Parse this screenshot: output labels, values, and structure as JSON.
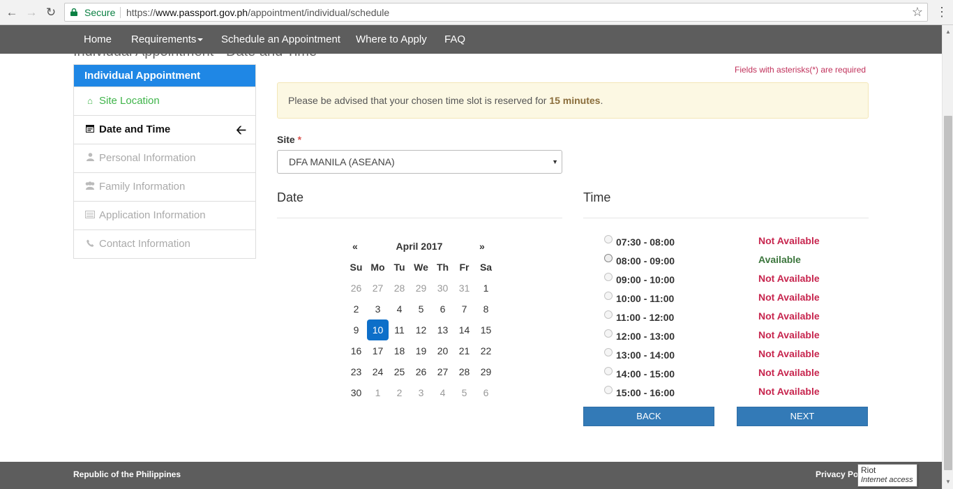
{
  "browser": {
    "secure_label": "Secure",
    "url_scheme": "https://",
    "url_host": "www.passport.gov.ph",
    "url_path": "/appointment/individual/schedule"
  },
  "nav": {
    "home": "Home",
    "requirements": "Requirements",
    "schedule": "Schedule an Appointment",
    "where": "Where to Apply",
    "faq": "FAQ"
  },
  "page_heading": "Individual Appointment - Date and Time",
  "sidebar": {
    "title": "Individual Appointment",
    "items": [
      {
        "label": "Site Location",
        "icon": "home-icon",
        "state": "done"
      },
      {
        "label": "Date and Time",
        "icon": "calendar-icon",
        "state": "active"
      },
      {
        "label": "Personal Information",
        "icon": "user-icon",
        "state": "pending"
      },
      {
        "label": "Family Information",
        "icon": "users-icon",
        "state": "pending"
      },
      {
        "label": "Application Information",
        "icon": "list-icon",
        "state": "pending"
      },
      {
        "label": "Contact Information",
        "icon": "phone-icon",
        "state": "pending"
      }
    ]
  },
  "required_note": "Fields with asterisks(*) are required",
  "alert": {
    "text": "Please be advised that your chosen time slot is reserved for ",
    "bold": "15 minutes",
    "end": "."
  },
  "site": {
    "label": "Site",
    "asterisk": "*",
    "value": "DFA MANILA (ASEANA)"
  },
  "date_title": "Date",
  "time_title": "Time",
  "calendar": {
    "prev": "«",
    "next": "»",
    "month": "April 2017",
    "weekdays": [
      "Su",
      "Mo",
      "Tu",
      "We",
      "Th",
      "Fr",
      "Sa"
    ],
    "weeks": [
      [
        "26",
        "27",
        "28",
        "29",
        "30",
        "31",
        "1"
      ],
      [
        "2",
        "3",
        "4",
        "5",
        "6",
        "7",
        "8"
      ],
      [
        "9",
        "10",
        "11",
        "12",
        "13",
        "14",
        "15"
      ],
      [
        "16",
        "17",
        "18",
        "19",
        "20",
        "21",
        "22"
      ],
      [
        "23",
        "24",
        "25",
        "26",
        "27",
        "28",
        "29"
      ],
      [
        "30",
        "1",
        "2",
        "3",
        "4",
        "5",
        "6"
      ]
    ],
    "selected": "10"
  },
  "slots": [
    {
      "range": "07:30 - 08:00",
      "status": "Not Available",
      "available": false
    },
    {
      "range": "08:00 - 09:00",
      "status": "Available",
      "available": true
    },
    {
      "range": "09:00 - 10:00",
      "status": "Not Available",
      "available": false
    },
    {
      "range": "10:00 - 11:00",
      "status": "Not Available",
      "available": false
    },
    {
      "range": "11:00 - 12:00",
      "status": "Not Available",
      "available": false
    },
    {
      "range": "12:00 - 13:00",
      "status": "Not Available",
      "available": false
    },
    {
      "range": "13:00 - 14:00",
      "status": "Not Available",
      "available": false
    },
    {
      "range": "14:00 - 15:00",
      "status": "Not Available",
      "available": false
    },
    {
      "range": "15:00 - 16:00",
      "status": "Not Available",
      "available": false
    }
  ],
  "buttons": {
    "back": "BACK",
    "next": "NEXT"
  },
  "footer": {
    "left": "Republic of the Philippines",
    "right": "Privacy Pol"
  },
  "tooltip": {
    "title": "Riot",
    "subtitle": "Internet access"
  },
  "colors": {
    "accent": "#1f87e5",
    "done": "#3fb44a",
    "not_available": "#c7254e",
    "available": "#3c763d",
    "button": "#337ab7",
    "navbar": "#5d5d5d"
  }
}
